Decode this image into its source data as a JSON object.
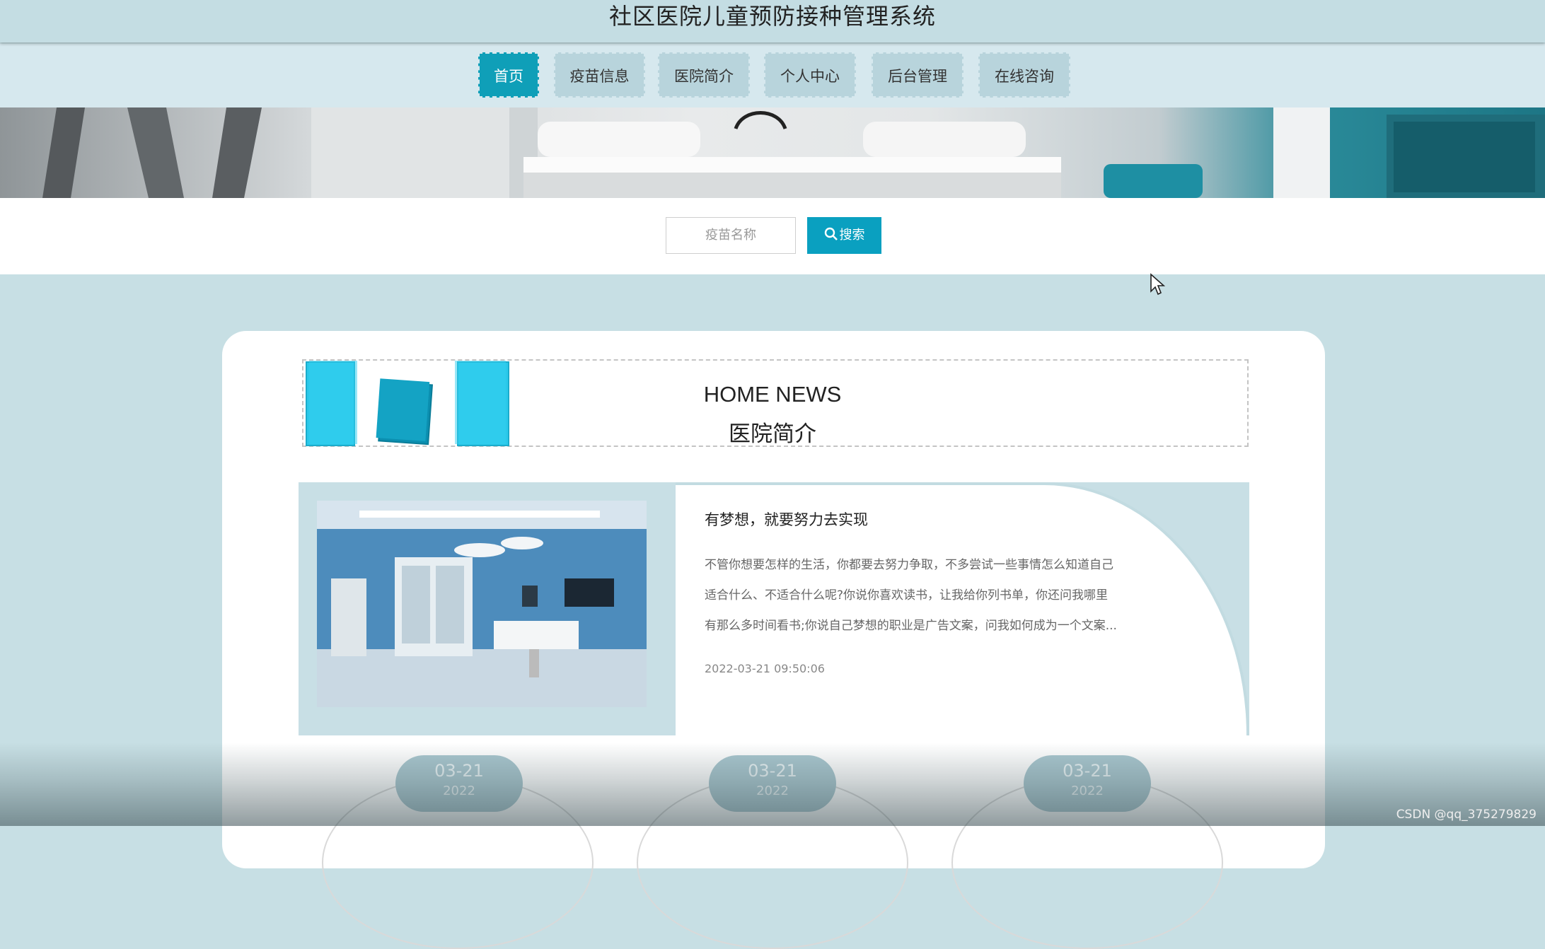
{
  "header": {
    "title": "社区医院儿童预防接种管理系统"
  },
  "nav": {
    "items": [
      {
        "label": "首页",
        "active": true
      },
      {
        "label": "疫苗信息",
        "active": false
      },
      {
        "label": "医院简介",
        "active": false
      },
      {
        "label": "个人中心",
        "active": false
      },
      {
        "label": "后台管理",
        "active": false
      },
      {
        "label": "在线咨询",
        "active": false
      }
    ]
  },
  "search": {
    "placeholder": "疫苗名称",
    "button_label": "搜索"
  },
  "news": {
    "heading_en": "HOME NEWS",
    "heading_cn": "医院简介",
    "article": {
      "title": "有梦想，就要努力去实现",
      "lines": [
        "不管你想要怎样的生活，你都要去努力争取，不多尝试一些事情怎么知道自己",
        "适合什么、不适合什么呢?你说你喜欢读书，让我给你列书单，你还问我哪里",
        "有那么多时间看书;你说自己梦想的职业是广告文案，问我如何成为一个文案..."
      ],
      "date": "2022-03-21 09:50:06"
    },
    "list_dates": [
      {
        "day": "03-21",
        "year": "2022"
      },
      {
        "day": "03-21",
        "year": "2022"
      },
      {
        "day": "03-21",
        "year": "2022"
      }
    ]
  },
  "watermark": "CSDN @qq_375279829",
  "colors": {
    "accent": "#0aa0c0",
    "nav_active": "#0f9fb8",
    "background": "#c7dfe4"
  },
  "icons": {
    "search": "magnifier-icon",
    "cursor": "mouse-pointer-icon"
  }
}
